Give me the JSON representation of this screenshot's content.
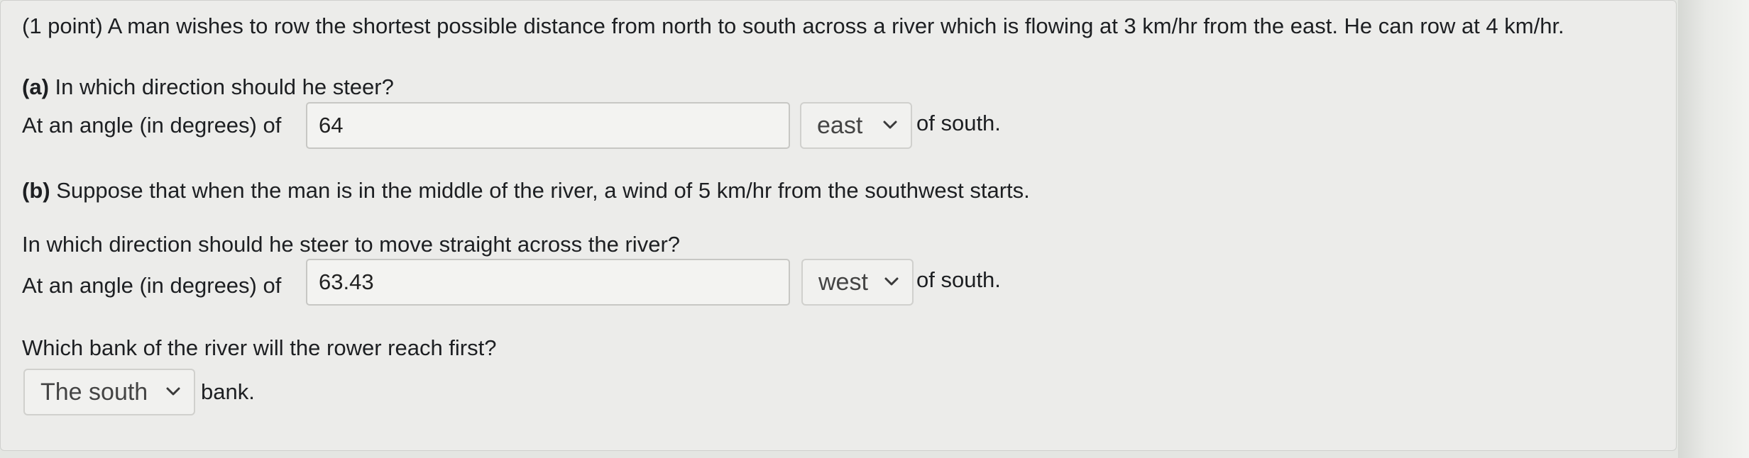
{
  "question": {
    "intro": "(1 point) A man wishes to row the shortest possible distance from north to south across a river which is flowing at 3 km/hr from the east. He can row at 4 km/hr.",
    "part_a": {
      "label": "(a)",
      "prompt": "In which direction should he steer?",
      "angle_prefix": "At an angle (in degrees) of",
      "angle_value": "64",
      "direction_selected": "east",
      "suffix": "of south."
    },
    "part_b": {
      "label": "(b)",
      "prompt": "Suppose that when the man is in the middle of the river, a wind of 5 km/hr from the southwest starts.",
      "steer_prompt": "In which direction should he steer to move straight across the river?",
      "angle_prefix": "At an angle (in degrees) of",
      "angle_value": "63.43",
      "direction_selected": "west",
      "suffix": "of south.",
      "bank_prompt": "Which bank of the river will the rower reach first?",
      "bank_selected": "The south",
      "bank_suffix": "bank."
    }
  },
  "icons": {
    "dropdown": "chevron-down-icon"
  },
  "colors": {
    "panel_bg": "#ececea",
    "text": "#1d1f22",
    "input_border": "#c7c7c4"
  }
}
